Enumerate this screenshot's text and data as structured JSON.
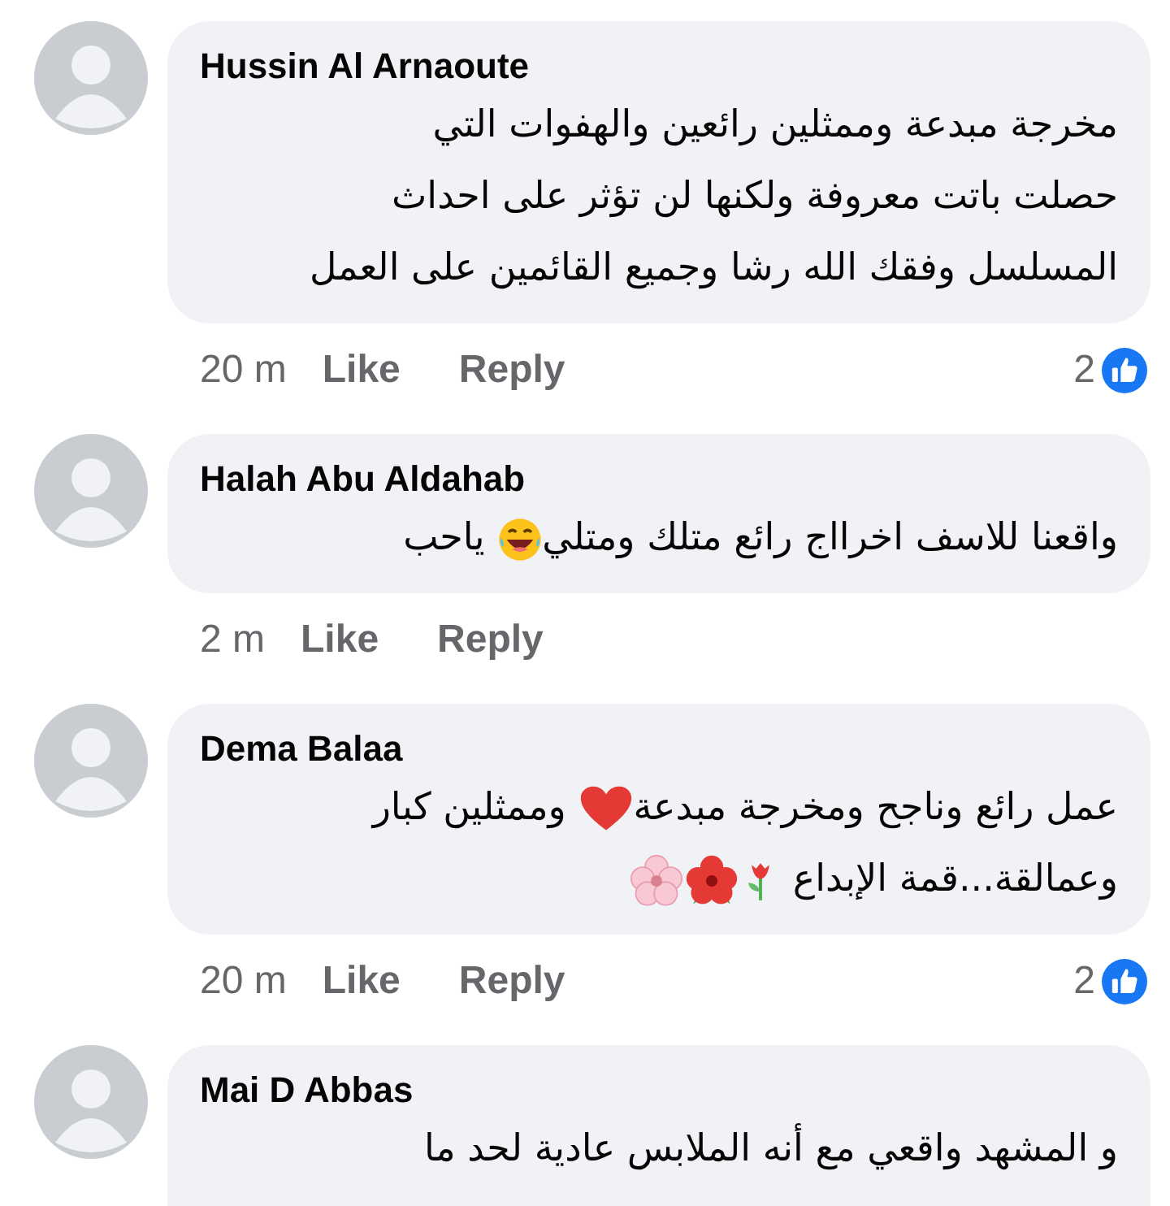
{
  "comments": [
    {
      "author": "Hussin Al Arnaoute",
      "lines": [
        [
          {
            "kind": "text",
            "text": "مخرجة مبدعة وممثلين رائعين والهفوات التي"
          }
        ],
        [
          {
            "kind": "text",
            "text": "حصلت باتت معروفة ولكنها لن تؤثر على احداث"
          }
        ],
        [
          {
            "kind": "text",
            "text": "المسلسل وفقك الله رشا وجميع القائمين على العمل"
          }
        ]
      ],
      "time": "20 m",
      "like": "Like",
      "reply": "Reply",
      "reactions": "2"
    },
    {
      "author": "Halah Abu Aldahab",
      "lines": [
        [
          {
            "kind": "text",
            "text": "واقعنا للاسف اخرااج رائع متلك ومتلي"
          },
          {
            "kind": "laugh"
          },
          {
            "kind": "text",
            "text": " ياحب"
          }
        ]
      ],
      "time": "2 m",
      "like": "Like",
      "reply": "Reply"
    },
    {
      "author": "Dema Balaa",
      "lines": [
        [
          {
            "kind": "text",
            "text": "عمل رائع وناجح ومخرجة مبدعة"
          },
          {
            "kind": "heart"
          },
          {
            "kind": "text",
            "text": " وممثلين كبار"
          }
        ],
        [
          {
            "kind": "text",
            "text": "وعمالقة...قمة الإبداع "
          },
          {
            "kind": "tulip"
          },
          {
            "kind": "hibiscus"
          },
          {
            "kind": "blossom"
          }
        ]
      ],
      "time": "20 m",
      "like": "Like",
      "reply": "Reply",
      "reactions": "2"
    },
    {
      "author": "Mai D Abbas",
      "lines": [
        [
          {
            "kind": "text",
            "text": "و المشهد واقعي مع أنه الملابس عادية لحد ما"
          }
        ]
      ]
    }
  ]
}
